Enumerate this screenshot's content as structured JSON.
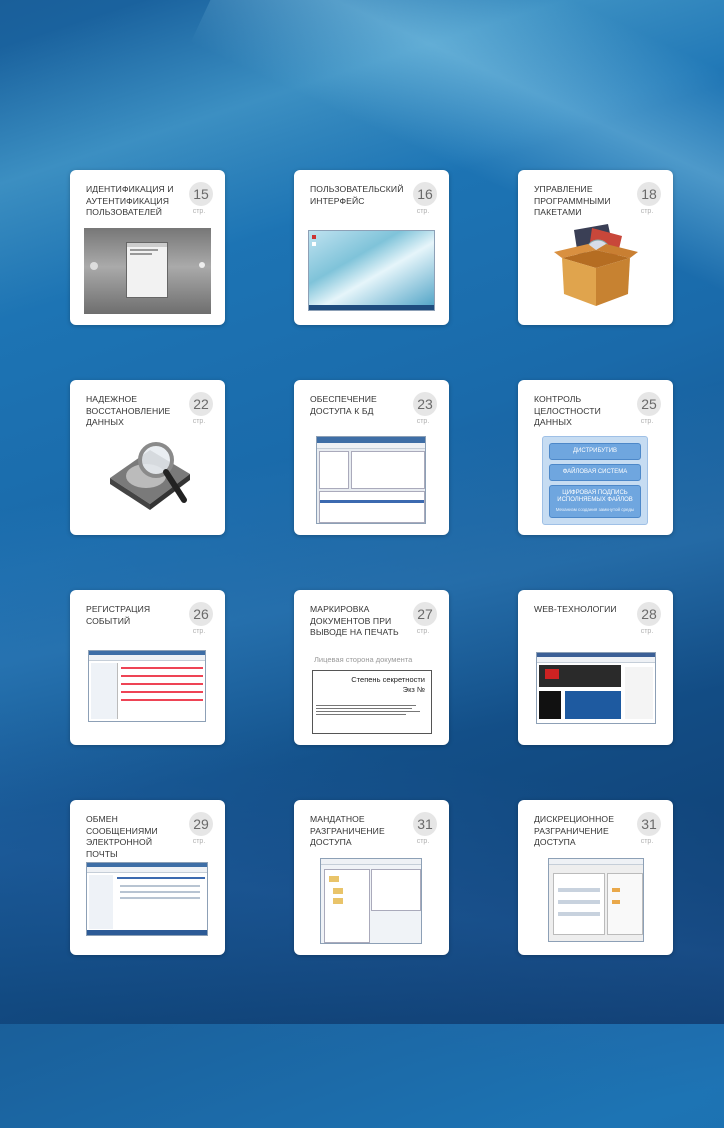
{
  "page_label_word": "стр.",
  "colors": {
    "background": "#1a6aaa",
    "card": "#ffffff",
    "badge": "#e6e6e6"
  },
  "cards": [
    {
      "id": "auth",
      "title": "ИДЕНТИФИКАЦИЯ И АУТЕНТИФИКАЦИЯ ПОЛЬЗОВАТЕЛЕЙ",
      "page": "15",
      "thumb": "login-screenshot"
    },
    {
      "id": "ui",
      "title": "ПОЛЬЗОВАТЕЛЬСКИЙ ИНТЕРФЕЙС",
      "page": "16",
      "thumb": "desktop-screenshot"
    },
    {
      "id": "packages",
      "title": "УПРАВЛЕНИЕ ПРОГРАММНЫМИ ПАКЕТАМИ",
      "page": "18",
      "thumb": "package-box-icon"
    },
    {
      "id": "recovery",
      "title": "НАДЕЖНОЕ ВОССТАНОВЛЕНИЕ ДАННЫХ",
      "page": "22",
      "thumb": "hard-drive-magnifier"
    },
    {
      "id": "db",
      "title": "ОБЕСПЕЧЕНИЕ ДОСТУПА К БД",
      "page": "23",
      "thumb": "db-screenshot"
    },
    {
      "id": "integrity",
      "title": "КОНТРОЛЬ ЦЕЛОСТНОСТИ ДАННЫХ",
      "page": "25",
      "thumb": "integrity-diagram",
      "diagram": {
        "item1": "ДИСТРИБУТИВ",
        "item2": "ФАЙЛОВАЯ СИСТЕМА",
        "item3": "ЦИФРОВАЯ ПОДПИСЬ ИСПОЛНЯЕМЫХ ФАЙЛОВ",
        "item3_sub": "Механизм создания замкнутой среды"
      }
    },
    {
      "id": "events",
      "title": "РЕГИСТРАЦИЯ СОБЫТИЙ",
      "page": "26",
      "thumb": "log-screenshot"
    },
    {
      "id": "marking",
      "title": "МАРКИРОВКА ДОКУМЕНТОВ ПРИ ВЫВОДЕ НА ПЕЧАТЬ",
      "page": "27",
      "thumb": "document-sample",
      "doc": {
        "caption": "Лицевая сторона документа",
        "line1": "Степень секретности",
        "line2": "Экз №"
      }
    },
    {
      "id": "web",
      "title": "WEB-ТЕХНОЛОГИИ",
      "page": "28",
      "thumb": "browser-screenshot"
    },
    {
      "id": "mail",
      "title": "ОБМЕН СООБЩЕНИЯМИ ЭЛЕКТРОННОЙ ПОЧТЫ",
      "page": "29",
      "thumb": "mail-screenshot"
    },
    {
      "id": "mandatory",
      "title": "МАНДАТНОЕ РАЗГРАНИЧЕНИЕ ДОСТУПА",
      "page": "31",
      "thumb": "mandatory-screenshot"
    },
    {
      "id": "discretionary",
      "title": "ДИСКРЕЦИОННОЕ РАЗГРАНИЧЕНИЕ ДОСТУПА",
      "page": "31",
      "thumb": "permissions-screenshot"
    }
  ]
}
